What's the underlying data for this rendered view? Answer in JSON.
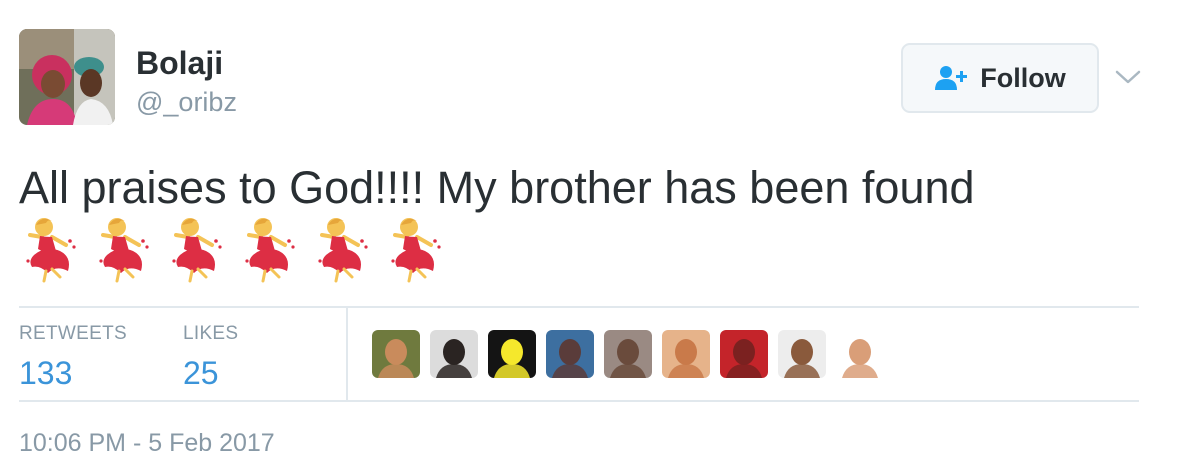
{
  "user": {
    "display_name": "Bolaji",
    "handle": "@_oribz"
  },
  "follow_button": {
    "label": "Follow"
  },
  "tweet": {
    "text": "All praises to God!!!! My brother has been found",
    "emoji": [
      "dancer-emoji",
      "dancer-emoji",
      "dancer-emoji",
      "dancer-emoji",
      "dancer-emoji",
      "dancer-emoji"
    ]
  },
  "stats": {
    "retweets_label": "RETWEETS",
    "retweets_count": "133",
    "likes_label": "LIKES",
    "likes_count": "25"
  },
  "likers": [
    {
      "color": "#c98b5c",
      "bg": "#6f7a3e"
    },
    {
      "color": "#2a2422",
      "bg": "#dcdcdc"
    },
    {
      "color": "#f5e82c",
      "bg": "#141414"
    },
    {
      "color": "#5a3c3a",
      "bg": "#3d6fa0"
    },
    {
      "color": "#6a4b3c",
      "bg": "#9a8a83"
    },
    {
      "color": "#c97a4a",
      "bg": "#e6b38a"
    },
    {
      "color": "#7b2120",
      "bg": "#c4242a"
    },
    {
      "color": "#8a5a3c",
      "bg": "#ededed"
    },
    {
      "color": "#d99e78",
      "bg": "#ffffff"
    }
  ],
  "timestamp": "10:06 PM - 5 Feb 2017",
  "colors": {
    "accent": "#3b94d9",
    "muted": "#8899a6",
    "text": "#292f33",
    "border": "#e1e8ed"
  }
}
